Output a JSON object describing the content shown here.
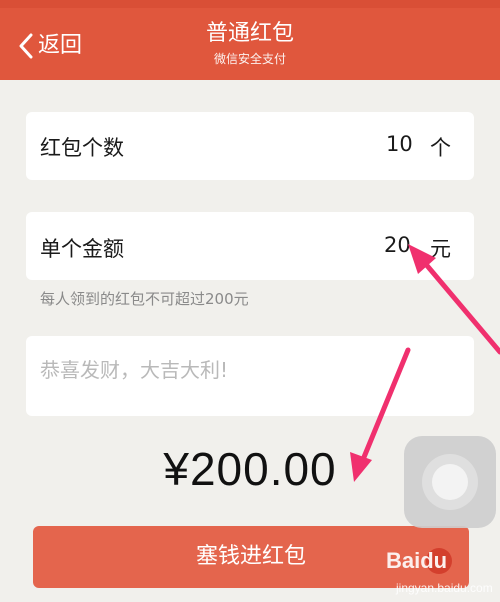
{
  "header": {
    "back_label": "返回",
    "title": "普通红包",
    "subtitle": "微信安全支付"
  },
  "form": {
    "count_label": "红包个数",
    "count_value": "10",
    "count_unit": "个",
    "amount_label": "单个金额",
    "amount_value": "20",
    "amount_unit": "元",
    "limit_note": "每人领到的红包不可超过200元",
    "message_placeholder": "恭喜发财，大吉大利!"
  },
  "total": "¥200.00",
  "submit_label": "塞钱进红包",
  "watermark": {
    "brand": "Baidu",
    "sub": "jingyan.baidu.com"
  },
  "colors": {
    "header": "#e0573d",
    "submit": "#e4654d",
    "annotation_arrow": "#f0306e"
  },
  "icons": [
    "chevron-left-icon",
    "assistive-touch-icon",
    "baidu-paw-icon"
  ]
}
